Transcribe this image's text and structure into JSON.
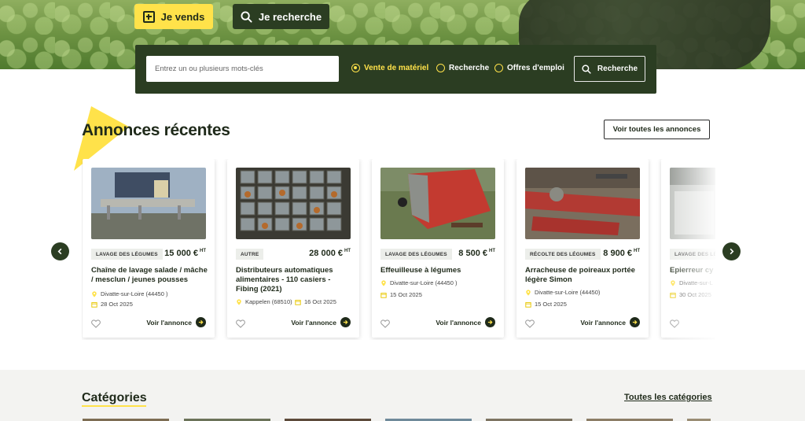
{
  "hero": {
    "sell_label": "Je vends",
    "search_label": "Je recherche",
    "search": {
      "placeholder": "Entrez un ou plusieurs mots-clés",
      "options": [
        {
          "label": "Vente de matériel",
          "selected": true
        },
        {
          "label": "Recherche",
          "selected": false
        },
        {
          "label": "Offres d'emploi",
          "selected": false
        }
      ],
      "submit_label": "Recherche"
    }
  },
  "recent": {
    "title": "Annonces récentes",
    "see_all_label": "Voir toutes les annonces",
    "cards": [
      {
        "tag": "LAVAGE DES LÉGUMES",
        "price": "15 000 €",
        "price_suffix": "HT",
        "title": "Chaîne de lavage salade / mâche / mesclun / jeunes pousses",
        "location": "Divatte-sur-Loire (44450 )",
        "date": "28 Oct 2025",
        "cta": "Voir l'annonce"
      },
      {
        "tag": "AUTRE",
        "price": "28 000 €",
        "price_suffix": "HT",
        "title": "Distributeurs automatiques alimentaires - 110 casiers - Fibing (2021)",
        "location": "Kappelen (68510)",
        "date": "16 Oct 2025",
        "cta": "Voir l'annonce"
      },
      {
        "tag": "LAVAGE DES LÉGUMES",
        "price": "8 500 €",
        "price_suffix": "HT",
        "title": "Effeuilleuse à légumes",
        "location": "Divatte-sur-Loire (44450 )",
        "date": "15 Oct 2025",
        "cta": "Voir l'annonce"
      },
      {
        "tag": "RÉCOLTE DES LÉGUMES",
        "price": "8 900 €",
        "price_suffix": "HT",
        "title": "Arracheuse de poireaux portée légère Simon",
        "location": "Divatte-sur-Loire (44450)",
        "date": "15 Oct 2025",
        "cta": "Voir l'annonce"
      },
      {
        "tag": "LAVAGE DES LÉ",
        "price": "",
        "price_suffix": "",
        "title": "Epierreur cy",
        "location": "Divatte-sur-L",
        "date": "30 Oct 2025",
        "cta": ""
      }
    ]
  },
  "categories": {
    "title": "Catégories",
    "all_label": "Toutes les catégories"
  },
  "colors": {
    "brand_dark": "#2b3d22",
    "accent_yellow": "#ffe24a"
  }
}
